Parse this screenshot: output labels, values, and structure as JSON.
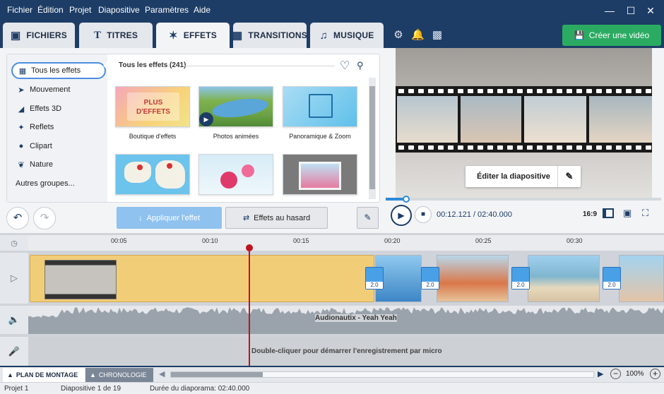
{
  "menu": {
    "items": [
      "Fichier",
      "Édition",
      "Projet",
      "Diapositive",
      "Paramètres",
      "Aide"
    ]
  },
  "tabs": [
    {
      "label": "FICHIERS",
      "icon": "add-file-icon"
    },
    {
      "label": "TITRES",
      "icon": "text-icon"
    },
    {
      "label": "EFFETS",
      "icon": "effects-star-icon",
      "active": true
    },
    {
      "label": "TRANSITIONS",
      "icon": "transitions-icon"
    },
    {
      "label": "MUSIQUE",
      "icon": "music-note-icon"
    }
  ],
  "toolbar": {
    "create_label": "Créer une vidéo"
  },
  "effects": {
    "categories": [
      "Tous les effets",
      "Mouvement",
      "Effets 3D",
      "Reflets",
      "Clipart",
      "Nature",
      "Autres groupes..."
    ],
    "header": "Tous les effets (241)",
    "thumbs": [
      {
        "label": "Boutique d'effets",
        "text": "PLUS D'EFFETS"
      },
      {
        "label": "Photos animées"
      },
      {
        "label": "Panoramique & Zoom"
      },
      {
        "label": ""
      },
      {
        "label": ""
      },
      {
        "label": ""
      }
    ],
    "apply_label": "Appliquer l'effet",
    "random_label": "Effets au hasard"
  },
  "preview": {
    "edit_label": "Éditer la diapositive",
    "time_current": "00:12.121",
    "time_total": "02:40.000",
    "ratio": "16:9",
    "progress": 0.075
  },
  "timeline": {
    "ruler": [
      "00:05",
      "00:10",
      "00:15",
      "00:20",
      "00:25",
      "00:30"
    ],
    "transitions": [
      "2.0",
      "2.0",
      "2.0",
      "2.0"
    ],
    "audio_label": "Audionautix - Yeah Yeah",
    "mic_label": "Double-cliquer pour démarrer l'enregistrement par micro"
  },
  "viewbar": {
    "storyboard": "PLAN DE MONTAGE",
    "chronology": "CHRONOLOGIE",
    "zoom": "100%"
  },
  "status": {
    "project": "Projet 1",
    "slide": "Diapositive 1 de 19",
    "duration": "Durée du diaporama: 02:40.000"
  },
  "colors": {
    "brand": "#1d3d66",
    "create": "#2bab62",
    "playhead": "#c1121f",
    "clip": "#f2cd78"
  }
}
